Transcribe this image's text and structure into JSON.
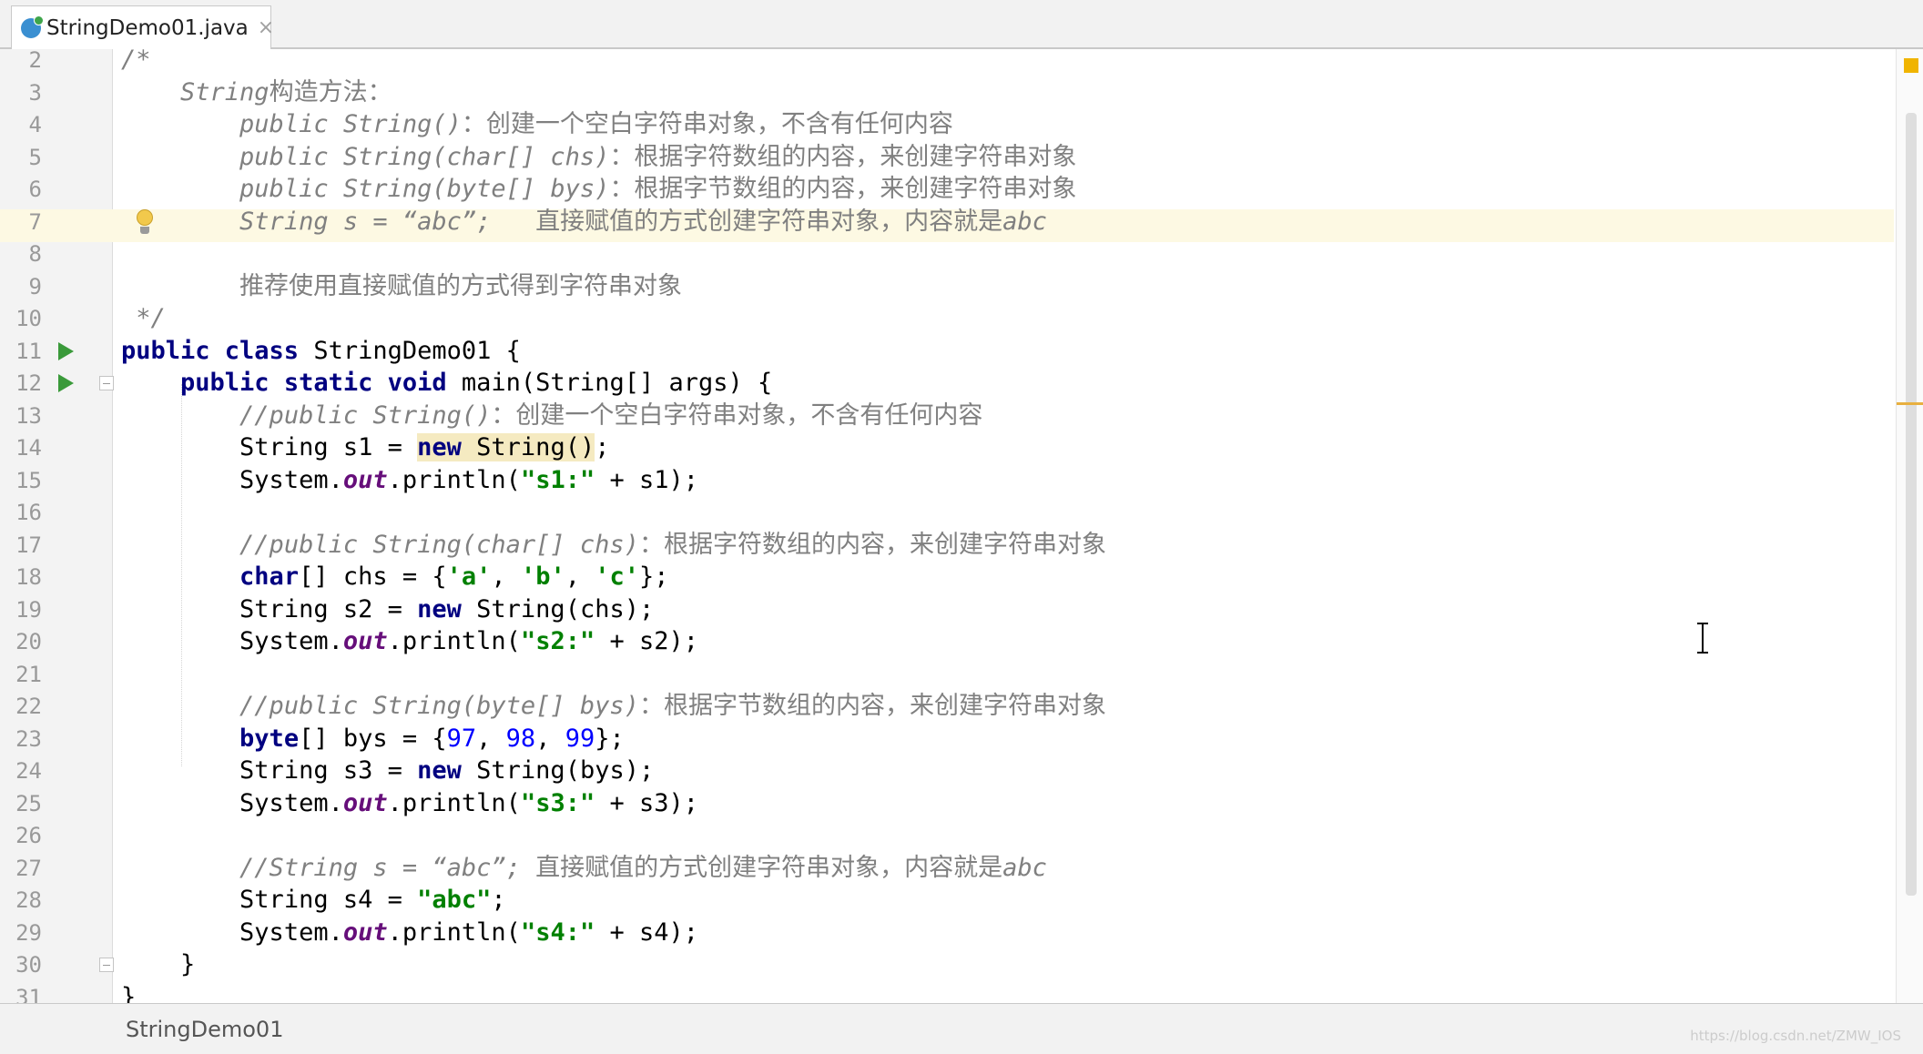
{
  "tab": {
    "filename": "StringDemo01.java",
    "close_icon": "×"
  },
  "code_lines": [
    {
      "num": "2",
      "indent": "",
      "segs": [
        [
          "c",
          "/*"
        ]
      ]
    },
    {
      "num": "3",
      "indent": "    ",
      "segs": [
        [
          "c",
          "String"
        ],
        [
          "cn",
          "构造方法："
        ]
      ]
    },
    {
      "num": "4",
      "indent": "        ",
      "segs": [
        [
          "c",
          "public String()"
        ],
        [
          "cn",
          "：创建一个空白字符串对象，不含有任何内容"
        ]
      ]
    },
    {
      "num": "5",
      "indent": "        ",
      "segs": [
        [
          "c",
          "public String(char[] chs)"
        ],
        [
          "cn",
          "：根据字符数组的内容，来创建字符串对象"
        ]
      ]
    },
    {
      "num": "6",
      "indent": "        ",
      "segs": [
        [
          "c",
          "public String(byte[] bys)"
        ],
        [
          "cn",
          "：根据字节数组的内容，来创建字符串对象"
        ]
      ]
    },
    {
      "num": "7",
      "indent": "        ",
      "segs": [
        [
          "c",
          "String s = “abc”;   "
        ],
        [
          "cn",
          "直接赋值的方式创建字符串对象，内容就是"
        ],
        [
          "c",
          "abc"
        ]
      ]
    },
    {
      "num": "8",
      "indent": "",
      "segs": []
    },
    {
      "num": "9",
      "indent": "        ",
      "segs": [
        [
          "cn",
          "推荐使用直接赋值的方式得到字符串对象"
        ]
      ]
    },
    {
      "num": "10",
      "indent": " ",
      "segs": [
        [
          "c",
          "*/"
        ]
      ]
    },
    {
      "num": "11",
      "indent": "",
      "segs": [
        [
          "k",
          "public class "
        ],
        [
          "p",
          "StringDemo01 {"
        ]
      ]
    },
    {
      "num": "12",
      "indent": "    ",
      "segs": [
        [
          "k",
          "public static void "
        ],
        [
          "p",
          "main(String[] args) {"
        ]
      ]
    },
    {
      "num": "13",
      "indent": "        ",
      "segs": [
        [
          "c",
          "//public String()"
        ],
        [
          "cn",
          "：创建一个空白字符串对象，不含有任何内容"
        ]
      ]
    },
    {
      "num": "14",
      "indent": "        ",
      "segs": [
        [
          "p",
          "String s1 = "
        ],
        [
          "knew",
          "new"
        ],
        [
          "pnew",
          " String()"
        ],
        [
          "p",
          ";"
        ]
      ]
    },
    {
      "num": "15",
      "indent": "        ",
      "segs": [
        [
          "p",
          "System."
        ],
        [
          "f",
          "out"
        ],
        [
          "p",
          ".println("
        ],
        [
          "s",
          "\"s1:\""
        ],
        [
          "p",
          " + s1);"
        ]
      ]
    },
    {
      "num": "16",
      "indent": "",
      "segs": []
    },
    {
      "num": "17",
      "indent": "        ",
      "segs": [
        [
          "c",
          "//public String(char[] chs)"
        ],
        [
          "cn",
          "：根据字符数组的内容，来创建字符串对象"
        ]
      ]
    },
    {
      "num": "18",
      "indent": "        ",
      "segs": [
        [
          "k",
          "char"
        ],
        [
          "p",
          "[] chs = {"
        ],
        [
          "s",
          "'a'"
        ],
        [
          "p",
          ", "
        ],
        [
          "s",
          "'b'"
        ],
        [
          "p",
          ", "
        ],
        [
          "s",
          "'c'"
        ],
        [
          "p",
          "};"
        ]
      ]
    },
    {
      "num": "19",
      "indent": "        ",
      "segs": [
        [
          "p",
          "String s2 = "
        ],
        [
          "k",
          "new "
        ],
        [
          "p",
          "String(chs);"
        ]
      ]
    },
    {
      "num": "20",
      "indent": "        ",
      "segs": [
        [
          "p",
          "System."
        ],
        [
          "f",
          "out"
        ],
        [
          "p",
          ".println("
        ],
        [
          "s",
          "\"s2:\""
        ],
        [
          "p",
          " + s2);"
        ]
      ]
    },
    {
      "num": "21",
      "indent": "",
      "segs": []
    },
    {
      "num": "22",
      "indent": "        ",
      "segs": [
        [
          "c",
          "//public String(byte[] bys)"
        ],
        [
          "cn",
          "：根据字节数组的内容，来创建字符串对象"
        ]
      ]
    },
    {
      "num": "23",
      "indent": "        ",
      "segs": [
        [
          "k",
          "byte"
        ],
        [
          "p",
          "[] bys = {"
        ],
        [
          "n",
          "97"
        ],
        [
          "p",
          ", "
        ],
        [
          "n",
          "98"
        ],
        [
          "p",
          ", "
        ],
        [
          "n",
          "99"
        ],
        [
          "p",
          "};"
        ]
      ]
    },
    {
      "num": "24",
      "indent": "        ",
      "segs": [
        [
          "p",
          "String s3 = "
        ],
        [
          "k",
          "new "
        ],
        [
          "p",
          "String(bys);"
        ]
      ]
    },
    {
      "num": "25",
      "indent": "        ",
      "segs": [
        [
          "p",
          "System."
        ],
        [
          "f",
          "out"
        ],
        [
          "p",
          ".println("
        ],
        [
          "s",
          "\"s3:\""
        ],
        [
          "p",
          " + s3);"
        ]
      ]
    },
    {
      "num": "26",
      "indent": "",
      "segs": []
    },
    {
      "num": "27",
      "indent": "        ",
      "segs": [
        [
          "c",
          "//String s = “abc”; "
        ],
        [
          "cn",
          "直接赋值的方式创建字符串对象，内容就是"
        ],
        [
          "c",
          "abc"
        ]
      ]
    },
    {
      "num": "28",
      "indent": "        ",
      "segs": [
        [
          "p",
          "String s4 = "
        ],
        [
          "s",
          "\"abc\""
        ],
        [
          "p",
          ";"
        ]
      ]
    },
    {
      "num": "29",
      "indent": "        ",
      "segs": [
        [
          "p",
          "System."
        ],
        [
          "f",
          "out"
        ],
        [
          "p",
          ".println("
        ],
        [
          "s",
          "\"s4:\""
        ],
        [
          "p",
          " + s4);"
        ]
      ]
    },
    {
      "num": "30",
      "indent": "    ",
      "segs": [
        [
          "p",
          "}"
        ]
      ]
    },
    {
      "num": "31",
      "indent": "",
      "segs": [
        [
          "p",
          "}"
        ]
      ]
    }
  ],
  "gutter_icons": {
    "run_lines": [
      "11",
      "12"
    ],
    "fold_lines": [
      "12",
      "30"
    ],
    "bulb_line": "7",
    "highlighted_line": "7"
  },
  "breadcrumb": "StringDemo01",
  "watermark": "https://blog.csdn.net/ZMW_IOS",
  "colors": {
    "keyword": "#000080",
    "string": "#008000",
    "number": "#0000ff",
    "comment": "#808080",
    "static_field": "#660e7a",
    "current_line": "#fdf9e3"
  }
}
